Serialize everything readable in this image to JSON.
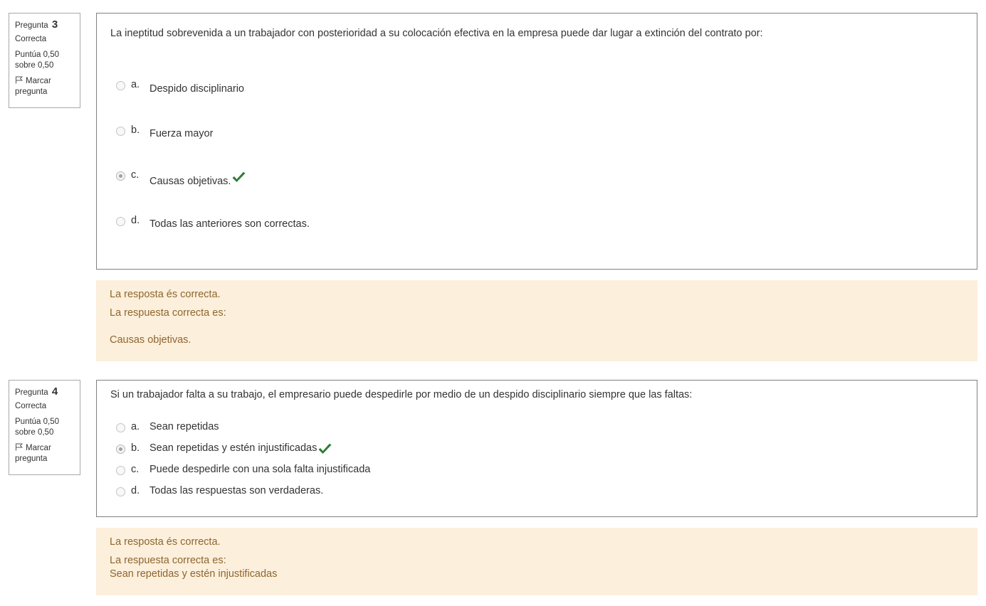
{
  "colors": {
    "feedback_bg": "#fcefdc",
    "feedback_text": "#8e662e",
    "correct_check": "#2e7d32",
    "border": "#808080"
  },
  "questions": [
    {
      "number_label": "Pregunta",
      "number": "3",
      "state": "Correcta",
      "grade_line1": "Puntúa 0,50",
      "grade_line2": "sobre 0,50",
      "flag_line1": "Marcar",
      "flag_line2": "pregunta",
      "flag_icon": "flag-icon",
      "text": "La ineptitud sobrevenida a un trabajador con posterioridad a su colocación efectiva en la empresa puede dar lugar a extinción del contrato por:",
      "options": [
        {
          "letter": "a.",
          "text": "Despido disciplinario",
          "selected": false,
          "correct": false
        },
        {
          "letter": "b.",
          "text": "Fuerza mayor",
          "selected": false,
          "correct": false
        },
        {
          "letter": "c.",
          "text": "Causas objetivas.",
          "selected": true,
          "correct": true
        },
        {
          "letter": "d.",
          "text": "Todas las anteriores son correctas.",
          "selected": false,
          "correct": false
        }
      ],
      "feedback": {
        "result": "La resposta és correcta.",
        "right_answer_label": "La respuesta correcta es:",
        "right_answer": "Causas objetivas."
      }
    },
    {
      "number_label": "Pregunta",
      "number": "4",
      "state": "Correcta",
      "grade_line1": "Puntúa 0,50",
      "grade_line2": "sobre 0,50",
      "flag_line1": "Marcar",
      "flag_line2": "pregunta",
      "flag_icon": "flag-icon",
      "text": "Si un trabajador falta a su trabajo, el empresario puede despedirle por medio de un despido disciplinario siempre que las faltas:",
      "options": [
        {
          "letter": "a.",
          "text": "Sean repetidas",
          "selected": false,
          "correct": false
        },
        {
          "letter": "b.",
          "text": "Sean repetidas y estén injustificadas",
          "selected": true,
          "correct": true
        },
        {
          "letter": "c.",
          "text": "Puede despedirle con una sola falta injustificada",
          "selected": false,
          "correct": false
        },
        {
          "letter": "d.",
          "text": "Todas las respuestas son verdaderas.",
          "selected": false,
          "correct": false
        }
      ],
      "feedback": {
        "result": "La resposta és correcta.",
        "right_answer_label": "La respuesta correcta es:",
        "right_answer": "Sean repetidas y estén injustificadas"
      }
    }
  ]
}
